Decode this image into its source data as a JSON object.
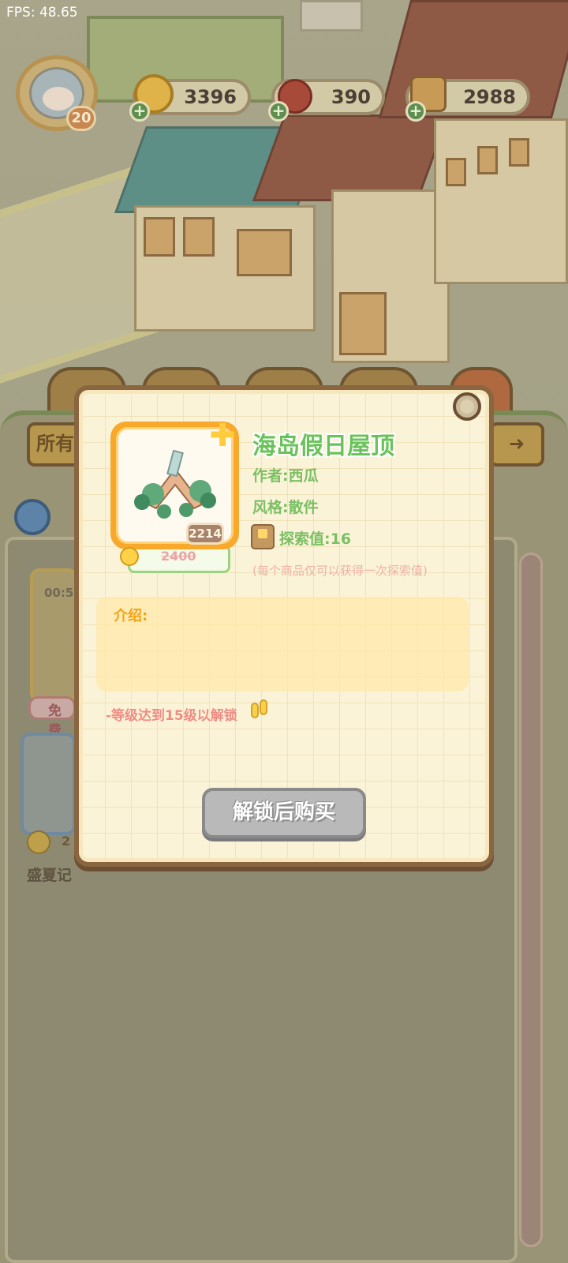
{
  "debug": {
    "fps_text": "FPS: 48.65"
  },
  "player": {
    "level": "20"
  },
  "currencies": {
    "coins": "3396",
    "fruit": "390",
    "explore": "2988"
  },
  "shop_background": {
    "tab_all_label": "所有",
    "card_timer": "00:5",
    "card_free_label": "免费",
    "card_price": "2",
    "card_name": "盛夏记"
  },
  "item_popup": {
    "title": "海岛假日屋顶",
    "author_label": "作者:",
    "author_value": "西瓜",
    "style_label": "风格:",
    "style_value": "散件",
    "explore_label": "探索值:",
    "explore_value": "16",
    "explore_note": "(每个商品仅可以获得一次探索值)",
    "owned_count": "2214",
    "price_original": "2400",
    "intro_label": "介绍:",
    "intro_text": "",
    "unlock_requirement": "-等级达到15级以解锁",
    "buy_button_label": "解锁后购买"
  },
  "icons": {
    "avatar": "player-avatar",
    "coin": "coin-icon",
    "fruit": "fruit-icon",
    "explore": "explore-book-icon",
    "add": "plus-icon",
    "close": "close-icon",
    "sparkle": "sparkle-icon",
    "footprints": "footprints-icon"
  },
  "colors": {
    "title_green": "#6ac35a",
    "popup_border": "#8a6640",
    "card_orange": "#f8a82a",
    "button_disabled": "#b9b9b9",
    "warning_pink": "#ef8c84"
  }
}
